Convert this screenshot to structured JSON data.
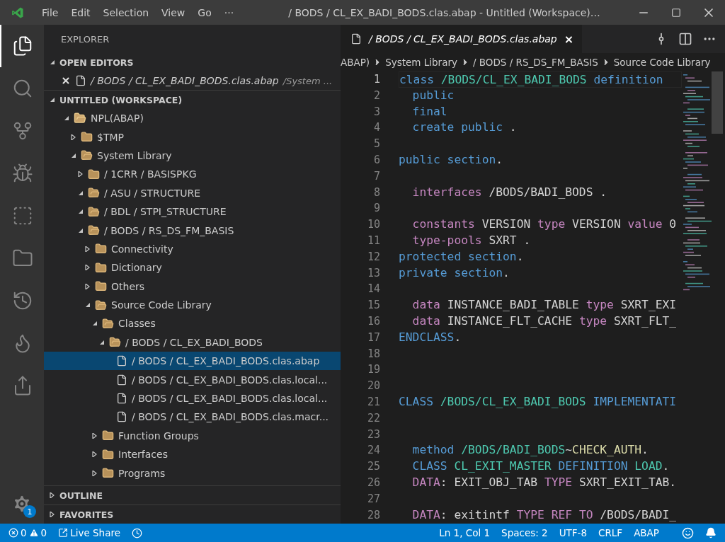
{
  "window": {
    "title": "/ BODS / CL_EX_BADI_BODS.clas.abap - Untitled (Workspace)…"
  },
  "menu": [
    "File",
    "Edit",
    "Selection",
    "View",
    "Go",
    "···"
  ],
  "activity_bar": {
    "items": [
      {
        "kind": "files",
        "selected": true
      },
      {
        "kind": "search",
        "selected": false
      },
      {
        "kind": "source-control",
        "selected": false
      },
      {
        "kind": "debug",
        "selected": false
      },
      {
        "kind": "extensions",
        "selected": false
      },
      {
        "kind": "folder",
        "selected": false
      },
      {
        "kind": "history",
        "selected": false
      },
      {
        "kind": "flame",
        "selected": false
      },
      {
        "kind": "share",
        "selected": false
      }
    ],
    "settings_badge": "1"
  },
  "sidebar": {
    "title": "EXPLORER",
    "open_editors": {
      "label": "OPEN EDITORS",
      "expanded": true,
      "items": [
        {
          "name": "/ BODS / CL_EX_BADI_BODS.clas.abap",
          "path": "/System ..."
        }
      ]
    },
    "workspace": {
      "label": "UNTITLED (WORKSPACE)",
      "expanded": true,
      "tree": [
        {
          "label": "NPL(ABAP)",
          "kind": "root",
          "expanded": true,
          "selected": false,
          "children": [
            {
              "label": "$TMP",
              "kind": "folder",
              "expanded": false,
              "selected": false
            },
            {
              "label": "System Library",
              "kind": "folder",
              "expanded": true,
              "selected": false,
              "children": [
                {
                  "label": "/ 1CRR / BASISPKG",
                  "kind": "folder",
                  "expanded": false,
                  "selected": false
                },
                {
                  "label": "/ ASU / STRUCTURE",
                  "kind": "folder",
                  "expanded": true,
                  "selected": false
                },
                {
                  "label": "/ BDL / STPI_STRUCTURE",
                  "kind": "folder",
                  "expanded": true,
                  "selected": false
                },
                {
                  "label": "/ BODS / RS_DS_FM_BASIS",
                  "kind": "folder",
                  "expanded": true,
                  "selected": false,
                  "children": [
                    {
                      "label": "Connectivity",
                      "kind": "folder",
                      "expanded": false,
                      "selected": false
                    },
                    {
                      "label": "Dictionary",
                      "kind": "folder",
                      "expanded": false,
                      "selected": false
                    },
                    {
                      "label": "Others",
                      "kind": "folder",
                      "expanded": false,
                      "selected": false
                    },
                    {
                      "label": "Source Code Library",
                      "kind": "folder",
                      "expanded": true,
                      "selected": false,
                      "children": [
                        {
                          "label": "Classes",
                          "kind": "folder",
                          "expanded": true,
                          "selected": false,
                          "children": [
                            {
                              "label": "/ BODS / CL_EX_BADI_BODS",
                              "kind": "folder",
                              "expanded": true,
                              "selected": false,
                              "children": [
                                {
                                  "label": "/ BODS / CL_EX_BADI_BODS.clas.abap",
                                  "kind": "file",
                                  "selected": true
                                },
                                {
                                  "label": "/ BODS / CL_EX_BADI_BODS.clas.local...",
                                  "kind": "file",
                                  "selected": false
                                },
                                {
                                  "label": "/ BODS / CL_EX_BADI_BODS.clas.local...",
                                  "kind": "file",
                                  "selected": false
                                },
                                {
                                  "label": "/ BODS / CL_EX_BADI_BODS.clas.macr...",
                                  "kind": "file",
                                  "selected": false
                                }
                              ]
                            }
                          ]
                        },
                        {
                          "label": "Function Groups",
                          "kind": "folder",
                          "expanded": false,
                          "selected": false
                        },
                        {
                          "label": "Interfaces",
                          "kind": "folder",
                          "expanded": false,
                          "selected": false
                        },
                        {
                          "label": "Programs",
                          "kind": "folder",
                          "expanded": false,
                          "selected": false
                        }
                      ]
                    }
                  ]
                }
              ]
            }
          ]
        }
      ]
    },
    "outline": {
      "label": "OUTLINE",
      "expanded": false
    },
    "favorites": {
      "label": "FAVORITES",
      "expanded": false
    }
  },
  "editor": {
    "tab": {
      "title": "/ BODS / CL_EX_BADI_BODS.clas.abap",
      "close": "×"
    },
    "breadcrumbs": [
      "ABAP)",
      "System Library",
      "/ BODS / RS_DS_FM_BASIS",
      "Source Code Library"
    ],
    "lines": [
      {
        "number": "1",
        "tokens": [
          {
            "kind": "keyword",
            "text": "class"
          },
          {
            "kind": "type",
            "text": " /BODS/CL_EX_BADI_BODS"
          },
          {
            "kind": "keyword",
            "text": " definition"
          }
        ]
      },
      {
        "number": "2",
        "tokens": [
          {
            "kind": "keyword",
            "text": "  public"
          }
        ]
      },
      {
        "number": "3",
        "tokens": [
          {
            "kind": "keyword",
            "text": "  final"
          }
        ]
      },
      {
        "number": "4",
        "tokens": [
          {
            "kind": "keyword",
            "text": "  create public"
          },
          {
            "kind": "plain",
            "text": " ."
          }
        ]
      },
      {
        "number": "5"
      },
      {
        "number": "6",
        "tokens": [
          {
            "kind": "keyword",
            "text": "public section"
          },
          {
            "kind": "plain",
            "text": "."
          }
        ]
      },
      {
        "number": "7"
      },
      {
        "number": "8",
        "tokens": [
          {
            "kind": "control",
            "text": "  interfaces"
          },
          {
            "kind": "plain",
            "text": " /BODS/BADI_BODS ."
          }
        ]
      },
      {
        "number": "9"
      },
      {
        "number": "10",
        "tokens": [
          {
            "kind": "control",
            "text": "  constants"
          },
          {
            "kind": "plain",
            "text": " VERSION "
          },
          {
            "kind": "control",
            "text": "type"
          },
          {
            "kind": "plain",
            "text": " VERSION "
          },
          {
            "kind": "control",
            "text": "value"
          },
          {
            "kind": "plain",
            "text": " 0"
          }
        ]
      },
      {
        "number": "11",
        "tokens": [
          {
            "kind": "control",
            "text": "  type-pools"
          },
          {
            "kind": "plain",
            "text": " SXRT ."
          }
        ]
      },
      {
        "number": "12",
        "tokens": [
          {
            "kind": "keyword",
            "text": "protected section"
          },
          {
            "kind": "plain",
            "text": "."
          }
        ]
      },
      {
        "number": "13",
        "tokens": [
          {
            "kind": "keyword",
            "text": "private section"
          },
          {
            "kind": "plain",
            "text": "."
          }
        ]
      },
      {
        "number": "14"
      },
      {
        "number": "15",
        "tokens": [
          {
            "kind": "control",
            "text": "  data"
          },
          {
            "kind": "plain",
            "text": " INSTANCE_BADI_TABLE "
          },
          {
            "kind": "control",
            "text": "type"
          },
          {
            "kind": "plain",
            "text": " SXRT_EXI"
          }
        ]
      },
      {
        "number": "16",
        "tokens": [
          {
            "kind": "control",
            "text": "  data"
          },
          {
            "kind": "plain",
            "text": " INSTANCE_FLT_CACHE "
          },
          {
            "kind": "control",
            "text": "type"
          },
          {
            "kind": "plain",
            "text": " SXRT_FLT_"
          }
        ]
      },
      {
        "number": "17",
        "tokens": [
          {
            "kind": "keyword",
            "text": "ENDCLASS"
          },
          {
            "kind": "plain",
            "text": "."
          }
        ]
      },
      {
        "number": "18"
      },
      {
        "number": "19"
      },
      {
        "number": "20"
      },
      {
        "number": "21",
        "tokens": [
          {
            "kind": "keyword",
            "text": "CLASS"
          },
          {
            "kind": "type",
            "text": " /BODS/CL_EX_BADI_BODS"
          },
          {
            "kind": "keyword",
            "text": " IMPLEMENTATI"
          }
        ]
      },
      {
        "number": "22"
      },
      {
        "number": "23"
      },
      {
        "number": "24",
        "tokens": [
          {
            "kind": "keyword",
            "text": "  method"
          },
          {
            "kind": "type",
            "text": " /BODS/BADI_BODS"
          },
          {
            "kind": "plain",
            "text": "~"
          },
          {
            "kind": "method",
            "text": "CHECK_AUTH"
          },
          {
            "kind": "plain",
            "text": "."
          }
        ]
      },
      {
        "number": "25",
        "tokens": [
          {
            "kind": "keyword",
            "text": "  CLASS"
          },
          {
            "kind": "type",
            "text": " CL_EXIT_MASTER"
          },
          {
            "kind": "keyword",
            "text": " DEFINITION"
          },
          {
            "kind": "type",
            "text": " LOAD"
          },
          {
            "kind": "plain",
            "text": "."
          }
        ]
      },
      {
        "number": "26",
        "tokens": [
          {
            "kind": "control",
            "text": "  DATA"
          },
          {
            "kind": "plain",
            "text": ": EXIT_OBJ_TAB "
          },
          {
            "kind": "control",
            "text": "TYPE"
          },
          {
            "kind": "plain",
            "text": " SXRT_EXIT_TAB."
          }
        ]
      },
      {
        "number": "27"
      },
      {
        "number": "28",
        "tokens": [
          {
            "kind": "control",
            "text": "  DATA"
          },
          {
            "kind": "plain",
            "text": ": exitintf "
          },
          {
            "kind": "control",
            "text": "TYPE REF TO"
          },
          {
            "kind": "plain",
            "text": " /BODS/BADI_"
          }
        ]
      }
    ]
  },
  "status_bar": {
    "errors": "0",
    "warnings": "0",
    "live_share": "Live Share",
    "position": "Ln 1, Col 1",
    "spaces": "Spaces: 2",
    "encoding": "UTF-8",
    "eol": "CRLF",
    "language": "ABAP"
  }
}
